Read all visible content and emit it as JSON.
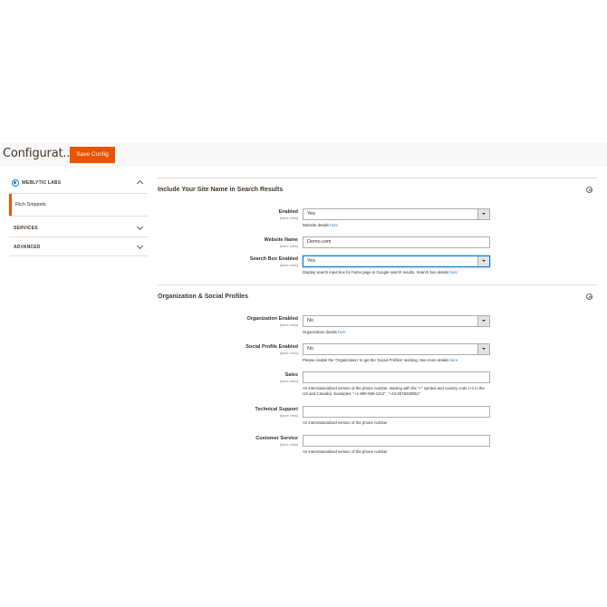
{
  "header": {
    "title": "Configurat...",
    "save_label": "Save Config"
  },
  "sidebar": {
    "brand": "WEBLYTIC LABS",
    "items": [
      {
        "label": "Rich Snippets"
      }
    ],
    "groups": [
      {
        "label": "SERVICES"
      },
      {
        "label": "ADVANCED"
      }
    ]
  },
  "sections": [
    {
      "title": "Include Your Site Name in Search Results",
      "fields": [
        {
          "label": "Enabled",
          "scope": "[store view]",
          "value": "Yes",
          "note": "Website details ",
          "link": "here"
        },
        {
          "label": "Website Name",
          "scope": "[store view]",
          "value": "Demo.com"
        },
        {
          "label": "Search Box Enabled",
          "scope": "[store view]",
          "value": "Yes",
          "note": "Display search input box for home page in Google search results. Search box details ",
          "link": "here"
        }
      ]
    },
    {
      "title": "Organization & Social Profiles",
      "fields": [
        {
          "label": "Organization Enabled",
          "scope": "[store view]",
          "value": "No",
          "note": "Organization details ",
          "link": "here"
        },
        {
          "label": "Social Profile Enabled",
          "scope": "[store view]",
          "value": "No",
          "note": "Please enable the 'Organization' to get the 'Social Profiles' working. See more details ",
          "link": "here"
        },
        {
          "label": "Sales",
          "scope": "[store view]",
          "value": "",
          "note": "An internationalized version of the phone number, starting with the \"+\" symbol and country code (+1 in the US and Canada). Examples: \"+1-800-555-1212\", \"+44-2078225951\""
        },
        {
          "label": "Technical Support",
          "scope": "[store view]",
          "value": "",
          "note": "An internationalized version of the phone number"
        },
        {
          "label": "Customer Service",
          "scope": "[store view]",
          "value": "",
          "note": "An internationalized version of the phone number"
        }
      ]
    }
  ],
  "colors": {
    "accent": "#eb5202",
    "link": "#1979c3"
  }
}
